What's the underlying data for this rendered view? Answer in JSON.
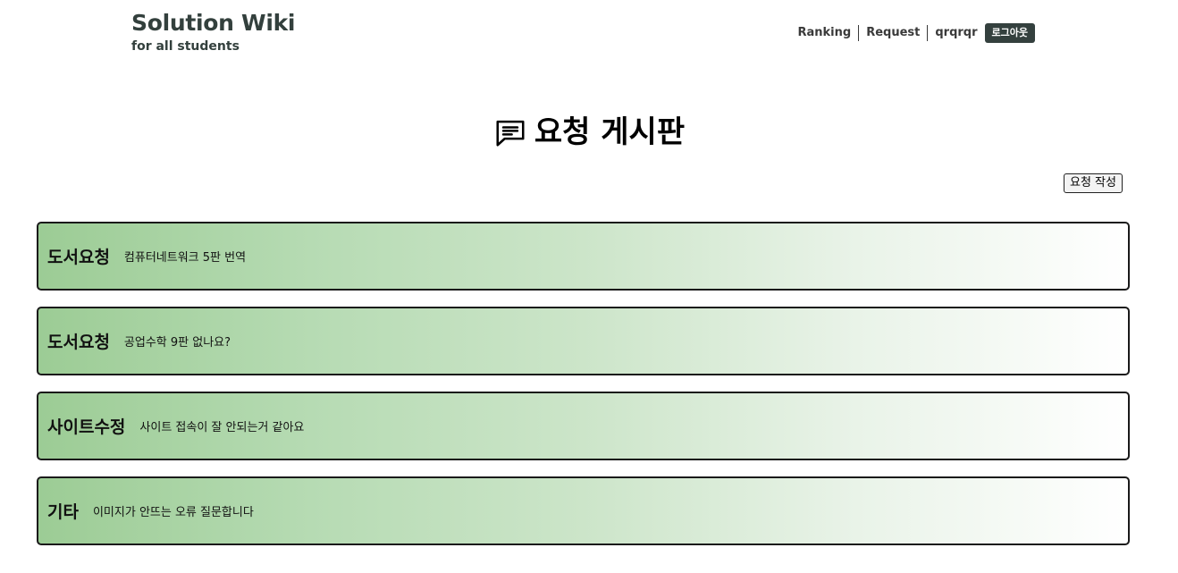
{
  "header": {
    "brand_title": "Solution Wiki",
    "brand_subtitle": "for all students",
    "nav": {
      "ranking": "Ranking",
      "request": "Request",
      "username": "qrqrqr",
      "logout": "로그아웃"
    }
  },
  "page": {
    "title": "요청 게시판",
    "title_icon": "message-square-lines-icon",
    "write_button": "요청 작성"
  },
  "requests": [
    {
      "category": "도서요청",
      "title": "컴퓨터네트워크 5판 번역"
    },
    {
      "category": "도서요청",
      "title": "공업수학 9판 없나요?"
    },
    {
      "category": "사이트수정",
      "title": "사이트 접속이 잘 안되는거 같아요"
    },
    {
      "category": "기타",
      "title": "이미지가 안뜨는 오류 질문합니다"
    }
  ],
  "colors": {
    "brand": "#33403d",
    "logout_bg": "#34403e",
    "card_gradient_start": "#9ccc95",
    "card_gradient_end": "#ffffff"
  }
}
